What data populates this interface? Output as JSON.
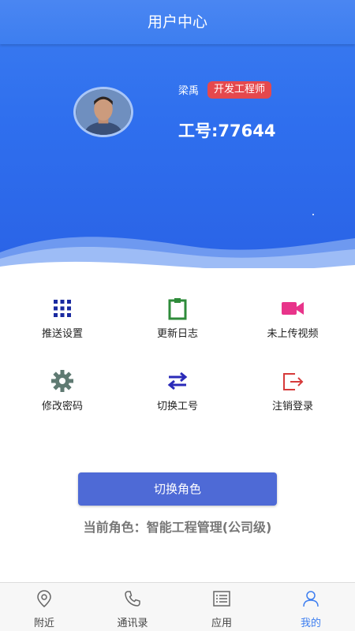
{
  "header": {
    "title": "用户中心"
  },
  "profile": {
    "name": "梁禹",
    "role_badge": "开发工程师",
    "employee_id": "工号:77644"
  },
  "grid": [
    {
      "label": "推送设置",
      "icon": "grid-dots-icon",
      "color": "#1a2aa0"
    },
    {
      "label": "更新日志",
      "icon": "clipboard-icon",
      "color": "#2e8b3a"
    },
    {
      "label": "未上传视频",
      "icon": "video-camera-icon",
      "color": "#e8348a"
    },
    {
      "label": "修改密码",
      "icon": "gear-icon",
      "color": "#5f7a72"
    },
    {
      "label": "切换工号",
      "icon": "swap-arrows-icon",
      "color": "#2a2ab8"
    },
    {
      "label": "注销登录",
      "icon": "logout-icon",
      "color": "#d63a3a"
    }
  ],
  "actions": {
    "switch_role": "切换角色",
    "current_role_prefix": "当前角色：",
    "current_role_value": "智能工程管理(公司级)"
  },
  "bottom_nav": [
    {
      "label": "附近",
      "icon": "location-pin-icon",
      "active": false
    },
    {
      "label": "通讯录",
      "icon": "phone-icon",
      "active": false
    },
    {
      "label": "应用",
      "icon": "list-icon",
      "active": false
    },
    {
      "label": "我的",
      "icon": "user-icon",
      "active": true
    }
  ],
  "colors": {
    "primary": "#3d7ef0",
    "badge": "#e5484d",
    "button": "#4e6ad6"
  }
}
